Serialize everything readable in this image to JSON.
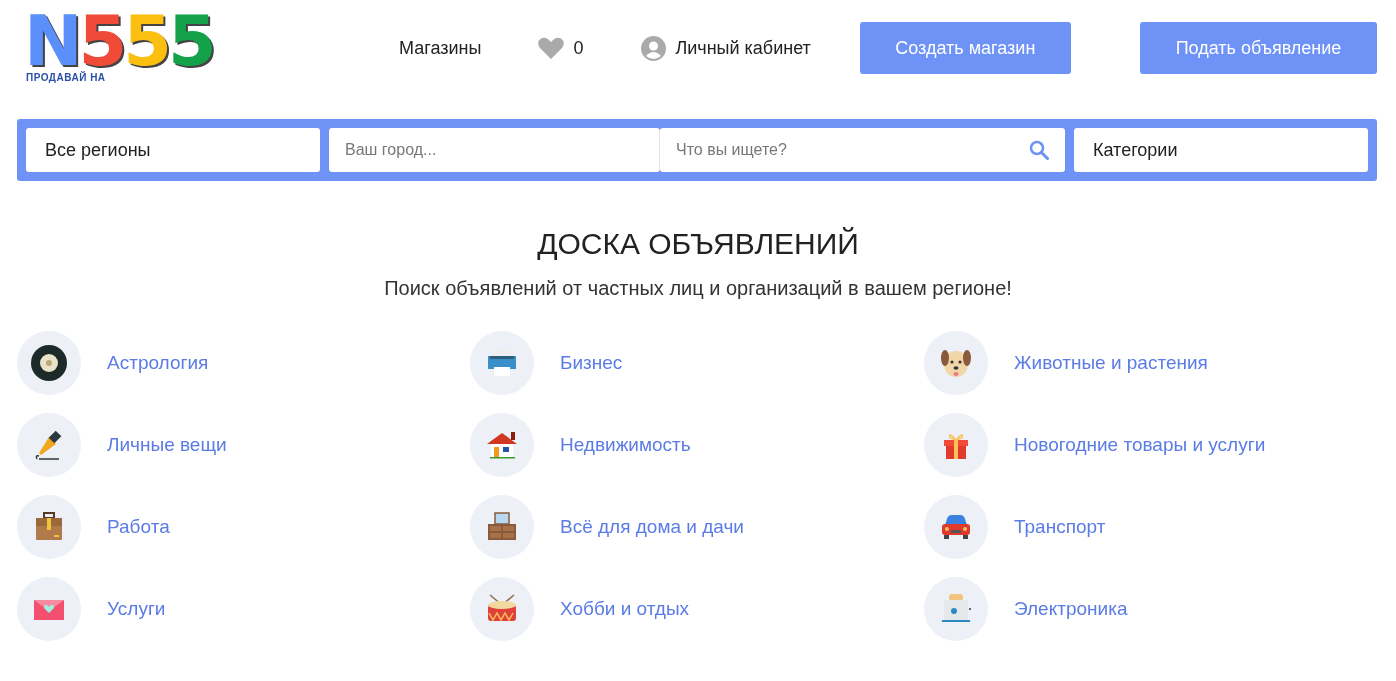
{
  "logo": {
    "letters": [
      {
        "text": "N",
        "color": "#5b8ff9"
      },
      {
        "text": "5",
        "color": "#f04a38"
      },
      {
        "text": "5",
        "color": "#fbbf0f"
      },
      {
        "text": "5",
        "color": "#13a24a"
      }
    ],
    "tagline": "ПРОДАВАЙ НА"
  },
  "nav": {
    "shops": "Магазины",
    "favorites_count": "0",
    "account": "Личный кабинет"
  },
  "buttons": [
    "Создать магазин",
    "Подать объявление"
  ],
  "search": {
    "region": "Все регионы",
    "city_placeholder": "Ваш город...",
    "query_placeholder": "Что вы ищете?",
    "category": "Категории"
  },
  "heading": "ДОСКА ОБЪЯВЛЕНИЙ",
  "subheading": "Поиск объявлений от частных лиц и организаций в вашем регионе!",
  "categories": [
    {
      "label": "Астрология"
    },
    {
      "label": "Бизнес"
    },
    {
      "label": "Животные и растения"
    },
    {
      "label": "Личные вещи"
    },
    {
      "label": "Недвижимость"
    },
    {
      "label": "Новогодние товары и услуги"
    },
    {
      "label": "Работа"
    },
    {
      "label": "Всё для дома и дачи"
    },
    {
      "label": "Транспорт"
    },
    {
      "label": "Услуги"
    },
    {
      "label": "Хобби и отдых"
    },
    {
      "label": "Электроника"
    }
  ]
}
